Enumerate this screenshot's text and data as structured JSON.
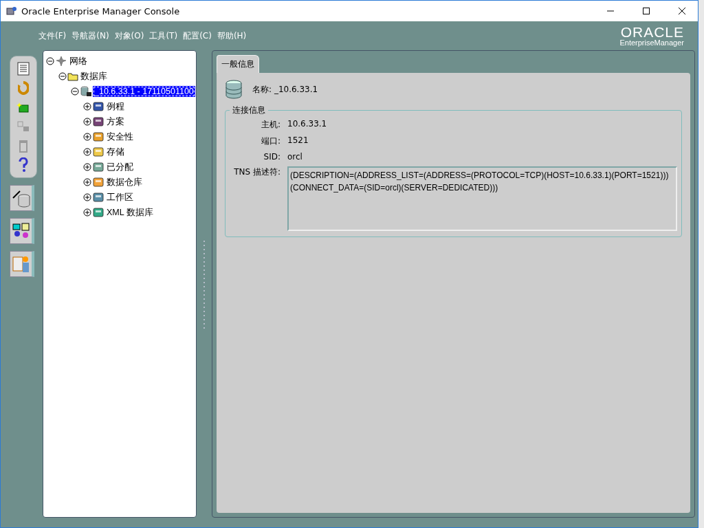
{
  "window": {
    "title": "Oracle Enterprise Manager Console"
  },
  "menu": [
    "文件(F)",
    "导航器(N)",
    "对象(O)",
    "工具(T)",
    "配置(C)",
    "帮助(H)"
  ],
  "logo": {
    "brand": "ORACLE",
    "product": "EnterpriseManager"
  },
  "toolbar": [
    {
      "kind": "document",
      "disabled": false
    },
    {
      "kind": "refresh",
      "disabled": false
    },
    {
      "kind": "create",
      "disabled": false
    },
    {
      "kind": "copy",
      "disabled": true
    },
    {
      "kind": "delete",
      "disabled": true
    },
    {
      "kind": "help",
      "disabled": false
    }
  ],
  "drawers": [
    {
      "kind": "database"
    },
    {
      "kind": "tools"
    },
    {
      "kind": "person"
    }
  ],
  "tree": [
    {
      "label": "网络",
      "kind": "network",
      "expanded": true,
      "selected": false,
      "children": [
        {
          "label": "数据库",
          "kind": "folder",
          "expanded": true,
          "selected": false,
          "children": [
            {
              "label": "_10.6.33.1 - 17110501100",
              "kind": "database",
              "expanded": true,
              "selected": true,
              "children": [
                {
                  "label": "例程",
                  "kind": "routine",
                  "expanded": false,
                  "selected": false
                },
                {
                  "label": "方案",
                  "kind": "schema",
                  "expanded": false,
                  "selected": false
                },
                {
                  "label": "安全性",
                  "kind": "security",
                  "expanded": false,
                  "selected": false
                },
                {
                  "label": "存储",
                  "kind": "storage",
                  "expanded": false,
                  "selected": false
                },
                {
                  "label": "已分配",
                  "kind": "distributed",
                  "expanded": false,
                  "selected": false
                },
                {
                  "label": "数据仓库",
                  "kind": "warehouse",
                  "expanded": false,
                  "selected": false
                },
                {
                  "label": "工作区",
                  "kind": "workspace",
                  "expanded": false,
                  "selected": false
                },
                {
                  "label": "XML 数据库",
                  "kind": "xml",
                  "expanded": false,
                  "selected": false
                }
              ]
            }
          ]
        }
      ]
    }
  ],
  "tabs": [
    {
      "label": "一般信息",
      "selected": true
    }
  ],
  "general": {
    "name_label": "名称:",
    "name_value": "_10.6.33.1"
  },
  "connection": {
    "title": "连接信息",
    "fields": [
      {
        "label": "主机:",
        "value": "10.6.33.1"
      },
      {
        "label": "端口:",
        "value": "1521"
      },
      {
        "label": "SID:",
        "value": "orcl"
      }
    ],
    "tns_label": "TNS 描述符:",
    "tns_value": "(DESCRIPTION=(ADDRESS_LIST=(ADDRESS=(PROTOCOL=TCP)(HOST=10.6.33.1)(PORT=1521)))(CONNECT_DATA=(SID=orcl)(SERVER=DEDICATED)))"
  }
}
